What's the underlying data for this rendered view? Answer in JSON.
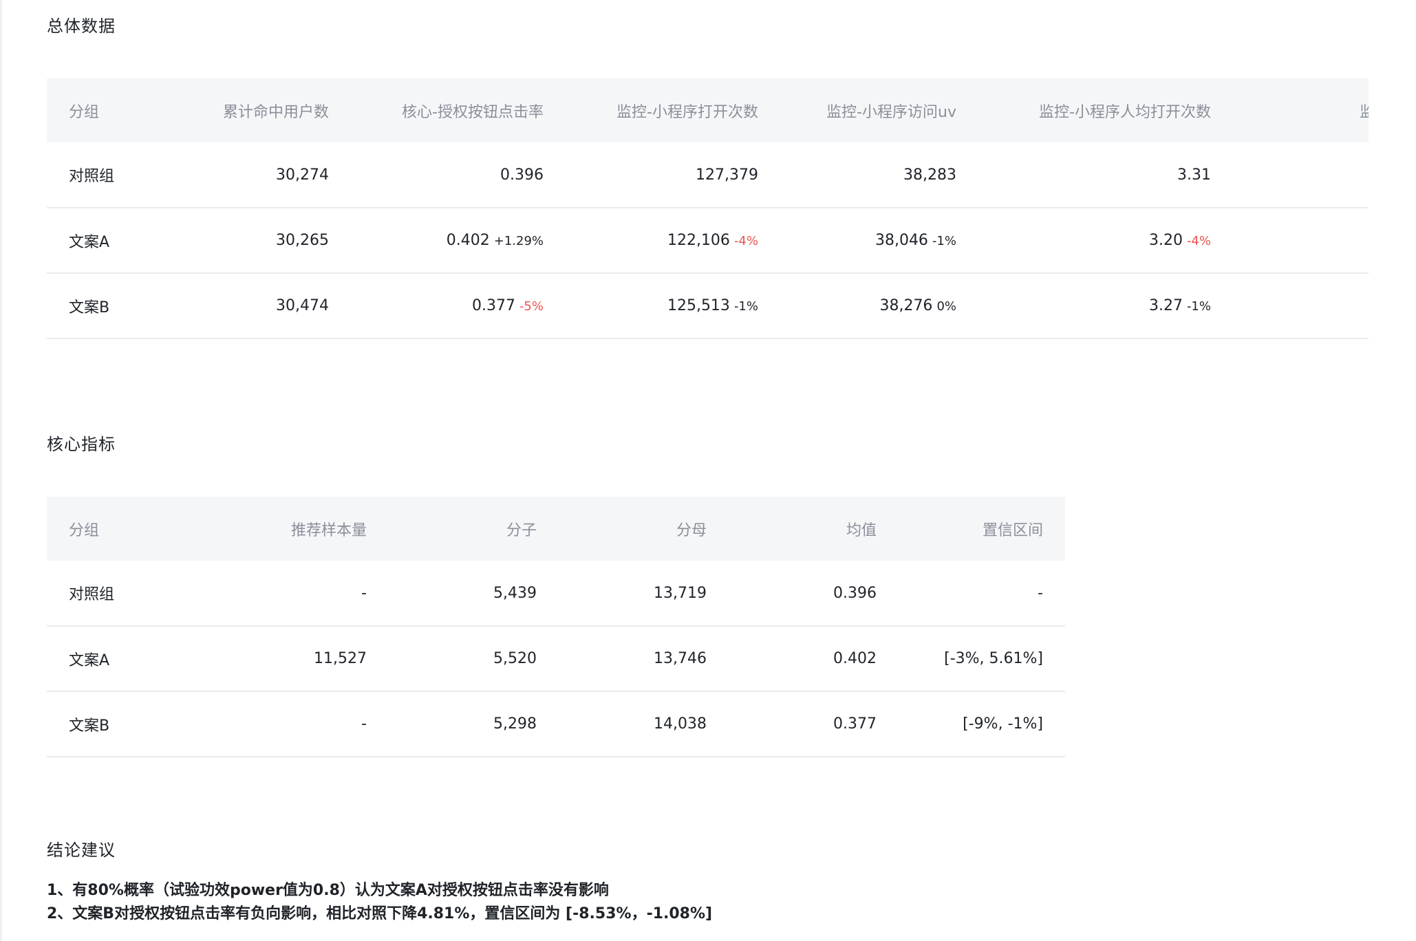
{
  "overall": {
    "title": "总体数据",
    "headers": [
      "分组",
      "累计命中用户数",
      "核心-授权按钮点击率",
      "监控-小程序打开次数",
      "监控-小程序访问uv",
      "监控-小程序人均打开次数",
      "监控-小程序人"
    ],
    "rows": [
      {
        "group": "对照组",
        "users": "30,274",
        "ctr": "0.396",
        "ctr_delta": "",
        "opens": "127,379",
        "opens_delta": "",
        "uv": "38,283",
        "uv_delta": "",
        "avg_opens": "3.31",
        "avg_opens_delta": ""
      },
      {
        "group": "文案A",
        "users": "30,265",
        "ctr": "0.402",
        "ctr_delta": "+1.29%",
        "opens": "122,106",
        "opens_delta": "-4%",
        "uv": "38,046",
        "uv_delta": "-1%",
        "avg_opens": "3.20",
        "avg_opens_delta": "-4%"
      },
      {
        "group": "文案B",
        "users": "30,474",
        "ctr": "0.377",
        "ctr_delta": "-5%",
        "opens": "125,513",
        "opens_delta": "-1%",
        "uv": "38,276",
        "uv_delta": "0%",
        "avg_opens": "3.27",
        "avg_opens_delta": "-1%"
      }
    ]
  },
  "core": {
    "title": "核心指标",
    "headers": [
      "分组",
      "推荐样本量",
      "分子",
      "分母",
      "均值",
      "置信区间"
    ],
    "rows": [
      {
        "group": "对照组",
        "sample": "-",
        "numerator": "5,439",
        "denominator": "13,719",
        "mean": "0.396",
        "ci": "-"
      },
      {
        "group": "文案A",
        "sample": "11,527",
        "numerator": "5,520",
        "denominator": "13,746",
        "mean": "0.402",
        "ci": "[-3%, 5.61%]"
      },
      {
        "group": "文案B",
        "sample": "-",
        "numerator": "5,298",
        "denominator": "14,038",
        "mean": "0.377",
        "ci": "[-9%, -1%]"
      }
    ]
  },
  "conclusion": {
    "title": "结论建议",
    "lines": [
      "1、有80%概率（试验功效power值为0.8）认为文案A对授权按钮点击率没有影响",
      "2、文案B对授权按钮点击率有负向影响，相比对照下降4.81%，置信区间为 [-8.53%，-1.08%]"
    ]
  },
  "colors": {
    "negative_delta": "#e8534f",
    "header_bg": "#f5f6f8",
    "header_text": "#8a8f99",
    "row_divider": "#e8eaed"
  }
}
